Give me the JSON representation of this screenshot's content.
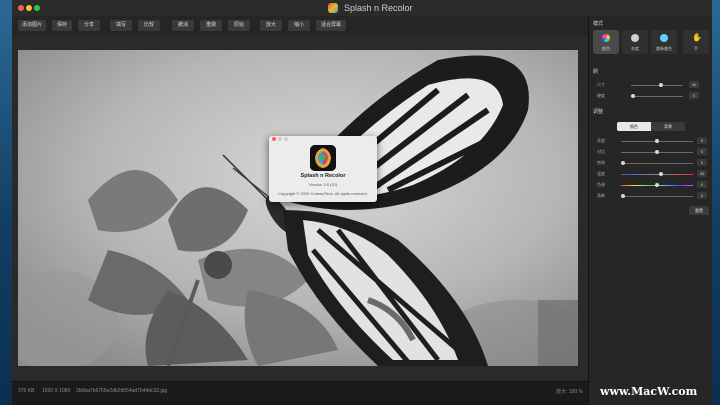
{
  "window": {
    "title": "Splash n Recolor"
  },
  "toolbar": {
    "add_image": "添加图片",
    "save": "保存",
    "share": "分享",
    "clone": "填写",
    "compare": "比较",
    "undo": "撤消",
    "redo": "重做",
    "reset": "原始",
    "zoom_in": "放大",
    "zoom_out": "缩小",
    "fit_screen": "适合屏幕"
  },
  "status": {
    "left": "376 KB",
    "size": "1920 X 1080",
    "filename": "2b6ba7b6766e2db2d554ad7644dc32.jpg",
    "zoom": "放大: 100 %"
  },
  "panel": {
    "mode_title": "模式",
    "modes": [
      {
        "label": "颜色",
        "icon": "color-wheel-icon"
      },
      {
        "label": "灰度",
        "icon": "paint-palette-icon"
      },
      {
        "label": "重新着色",
        "icon": "recolor-icon"
      },
      {
        "label": "手",
        "icon": "hand-icon"
      }
    ],
    "brush_title": "刷",
    "brush_sliders": [
      {
        "label": "尺寸",
        "value": "40",
        "position": 0.6
      },
      {
        "label": "硬度",
        "value": "0",
        "position": 0.0
      }
    ],
    "adjust_title": "调整",
    "segment": {
      "color": "颜色",
      "background": "背景"
    },
    "adjust_sliders": [
      {
        "label": "亮度",
        "value": "0",
        "position": 0.5
      },
      {
        "label": "对比",
        "value": "0",
        "position": 0.5
      },
      {
        "label": "饱和",
        "value": "0",
        "position": 0.0
      },
      {
        "label": "温度",
        "value": "30",
        "position": 0.55
      },
      {
        "label": "色调",
        "value": "0",
        "position": 0.5
      },
      {
        "label": "清晰",
        "value": "0",
        "position": 0.0
      }
    ],
    "reset_label": "重置"
  },
  "about": {
    "app_name": "Splash n Recolor",
    "version": "Version 3.5 (10)",
    "copyright": "Copyright © 2020 CubesoTech. All rights reserved."
  },
  "watermark": "www.MacW.com",
  "colors": {
    "accent": "#3a7bd5",
    "close": "#fe5f57",
    "minimize": "#febc2e",
    "maximize": "#28c840"
  }
}
